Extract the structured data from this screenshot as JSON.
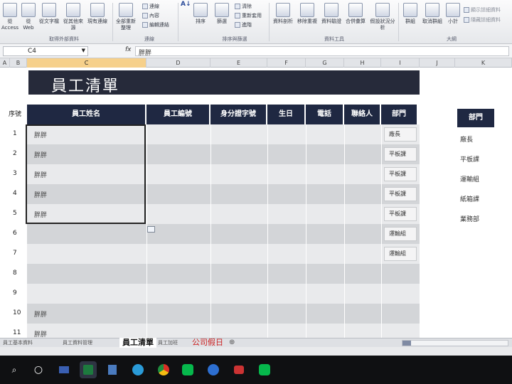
{
  "ribbon": {
    "from_access_label": "從Access",
    "from_web_label": "從 Web",
    "from_text_label": "從文字檔",
    "from_other_label": "從其他來源",
    "existing_conn_label": "現有連線",
    "group_external": "取得外部資料",
    "refresh_all_label": "全部重新整理",
    "connections_label": "連線",
    "properties_label": "內容",
    "edit_links_label": "編輯連結",
    "group_connections": "連線",
    "sort_label": "排序",
    "filter_label": "篩選",
    "clear_label": "清除",
    "reapply_label": "重新套用",
    "advanced_label": "進階",
    "group_sort": "排序與篩選",
    "text_to_columns_label": "資料剖析",
    "remove_dup_label": "移除重複",
    "validation_label": "資料驗證",
    "consolidate_label": "合併彙算",
    "whatif_label": "假設狀況分析",
    "group_tools": "資料工具",
    "group_label": "群組",
    "ungroup_label": "取消群組",
    "subtotal_label": "小計",
    "show_detail_label": "顯示詳細資料",
    "hide_detail_label": "隱藏詳細資料",
    "group_outline": "大綱"
  },
  "formula_bar": {
    "name_box": "C4",
    "fx": "fx",
    "value": "胖胖"
  },
  "columns": [
    "A",
    "B",
    "C",
    "D",
    "E",
    "F",
    "G",
    "H",
    "I",
    "J",
    "K"
  ],
  "sheet": {
    "title": "員工清單",
    "seq_header": "序號",
    "headers": [
      "員工姓名",
      "員工編號",
      "身分證字號",
      "生日",
      "電話",
      "聯絡人",
      "部門"
    ],
    "rows": [
      {
        "num": "1",
        "name": "胖胖",
        "dept": "廠長"
      },
      {
        "num": "2",
        "name": "胖胖",
        "dept": "平板課"
      },
      {
        "num": "3",
        "name": "胖胖",
        "dept": "平板課"
      },
      {
        "num": "4",
        "name": "胖胖",
        "dept": "平板課"
      },
      {
        "num": "5",
        "name": "胖胖",
        "dept": "平板課"
      },
      {
        "num": "6",
        "name": "",
        "dept": "運輸組"
      },
      {
        "num": "7",
        "name": "",
        "dept": "運輸組"
      },
      {
        "num": "8",
        "name": "",
        "dept": ""
      },
      {
        "num": "9",
        "name": "",
        "dept": ""
      },
      {
        "num": "10",
        "name": "胖胖",
        "dept": ""
      },
      {
        "num": "11",
        "name": "胖胖",
        "dept": ""
      }
    ],
    "dept_list_header": "部門",
    "dept_list": [
      "廠長",
      "平板課",
      "運輸組",
      "紙箱課",
      "業務部"
    ]
  },
  "tabs": [
    {
      "label": "員工基本資料"
    },
    {
      "label": "員工資料管理"
    },
    {
      "label": "員工清單",
      "active": true
    },
    {
      "label": "員工加班"
    },
    {
      "label": "公司假日",
      "red": true
    }
  ],
  "taskbar": {
    "icons": [
      "search-icon",
      "cortana-icon",
      "file-explorer-icon",
      "excel-icon",
      "notepad-icon",
      "edge-icon",
      "chrome-icon",
      "line-icon",
      "teams-icon",
      "camera-icon",
      "line2-icon"
    ]
  }
}
